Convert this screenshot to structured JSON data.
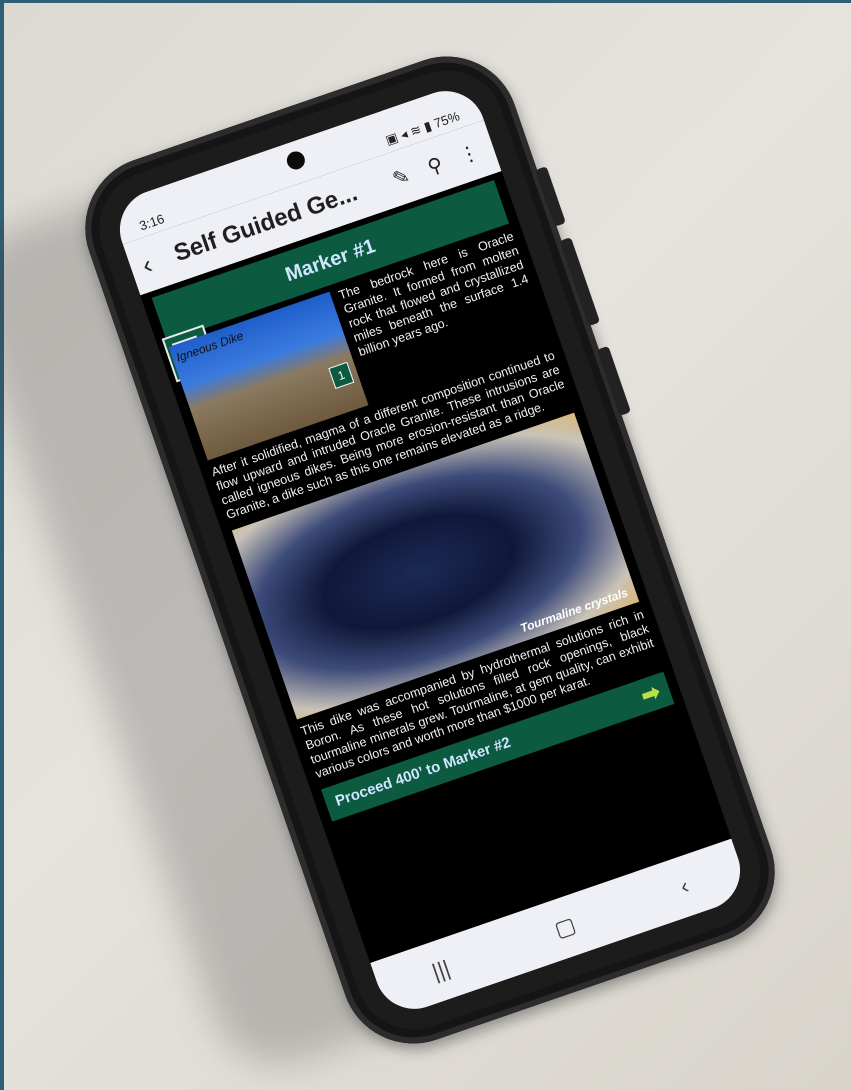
{
  "status_bar": {
    "time": "3:16",
    "battery": "75%",
    "icons": "▣ ◂ ≋ ▮"
  },
  "app_bar": {
    "title": "Self Guided Ge...",
    "back_icon": "‹",
    "edit_icon": "✎",
    "search_icon": "⚲",
    "more_icon": "⋮"
  },
  "marker": {
    "title": "Marker #1"
  },
  "photo1": {
    "caption": "Igneous Dike",
    "marker_number": "1"
  },
  "paragraph1": "The bedrock here is Oracle Granite. It formed from molten rock that flowed and crystallized miles beneath the surface 1.4 billion years ago.",
  "paragraph2": "After it solidified, magma of a different composition continued to flow upward and intruded Oracle Granite. These intrusions are called igneous dikes. Being more erosion-resistant than Oracle Granite, a dike such as this one remains elevated as a ridge.",
  "photo2": {
    "caption": "Tourmaline crystals"
  },
  "paragraph3": "This dike was accompanied by hydrothermal solutions rich in Boron. As these hot solutions filled rock openings, black tourmaline minerals grew. Tourmaline, at gem quality, can exhibit various colors and worth more than $1000 per karat.",
  "proceed": {
    "label": "Proceed 400’ to Marker #2",
    "arrow": "➡"
  },
  "nav": {
    "recents": "|||",
    "home": "▢",
    "back": "‹"
  }
}
